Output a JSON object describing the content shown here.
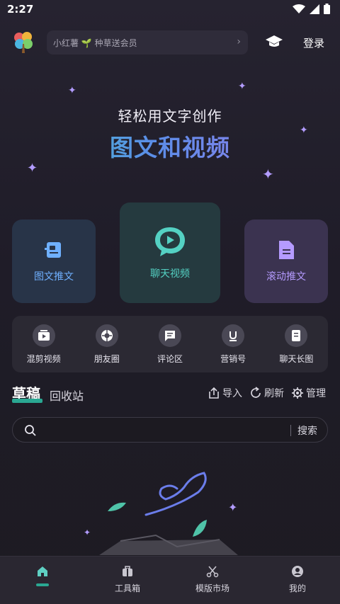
{
  "status": {
    "time": "2:27"
  },
  "topbar": {
    "promo_text": "小红薯 🌱 种草送会员",
    "login_label": "登录"
  },
  "hero": {
    "subtitle": "轻松用文字创作",
    "title": "图文和视频"
  },
  "features": {
    "tuwen": "图文推文",
    "chat_video": "聊天视频",
    "scroll": "滚动推文"
  },
  "tools": [
    "混剪视频",
    "朋友圈",
    "评论区",
    "营销号",
    "聊天长图"
  ],
  "drafts": {
    "tab_active": "草稿",
    "tab_recycle": "回收站",
    "import": "导入",
    "refresh": "刷新",
    "manage": "管理"
  },
  "search": {
    "button": "搜索"
  },
  "nav": {
    "tools": "工具箱",
    "templates": "模版市场",
    "me": "我的"
  },
  "colors": {
    "accent": "#2aa792",
    "tuwen": "#6fb0ff",
    "chat": "#54d1c3",
    "scroll": "#b59bff"
  }
}
